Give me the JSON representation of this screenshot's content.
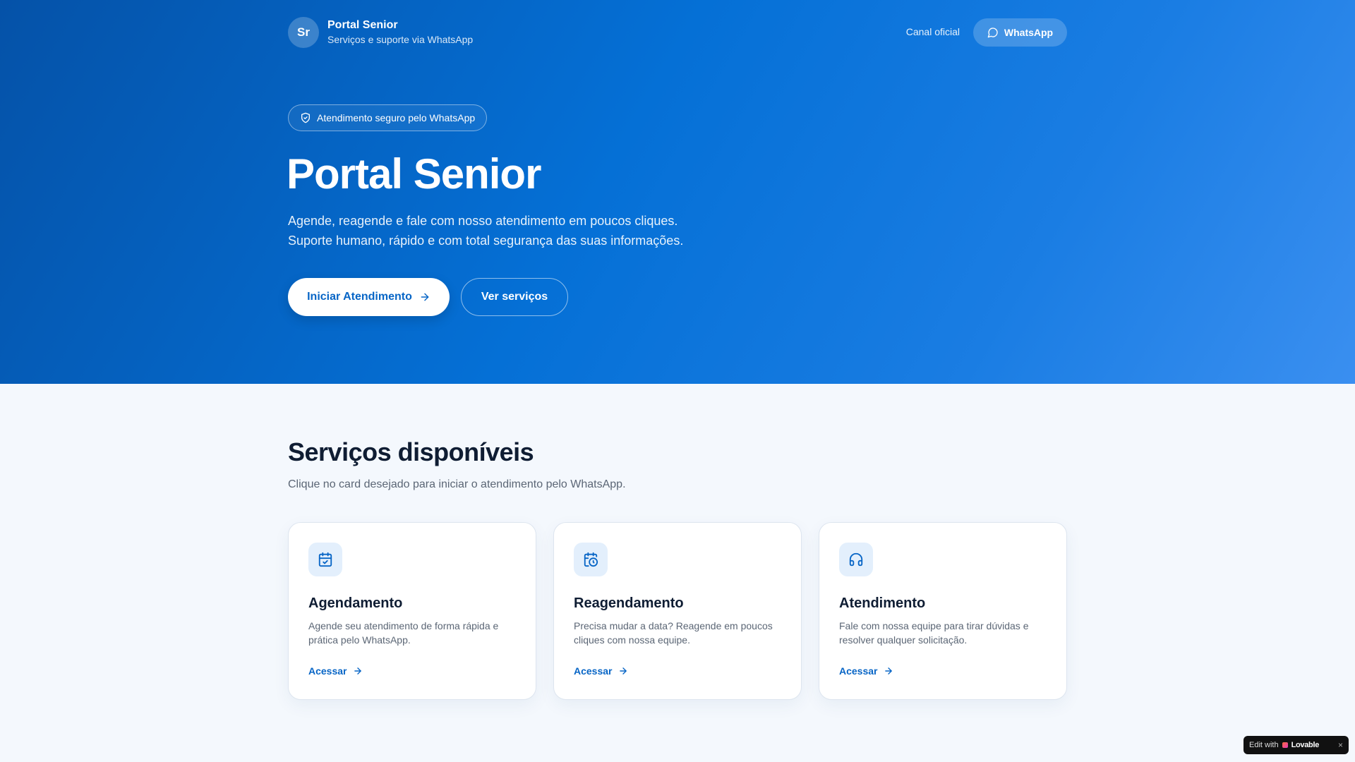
{
  "header": {
    "avatar_initials": "Sr",
    "brand_name": "Portal Senior",
    "brand_subtitle": "Serviços e suporte via WhatsApp",
    "canal_link": "Canal oficial",
    "whatsapp_button": "WhatsApp"
  },
  "hero": {
    "badge": "Atendimento seguro pelo WhatsApp",
    "title": "Portal Senior",
    "subtitle_line1": "Agende, reagende e fale com nosso atendimento em poucos cliques.",
    "subtitle_line2": "Suporte humano, rápido e com total segurança das suas informações.",
    "primary_button": "Iniciar Atendimento",
    "secondary_button": "Ver serviços"
  },
  "services": {
    "title": "Serviços disponíveis",
    "subtitle": "Clique no card desejado para iniciar o atendimento pelo WhatsApp.",
    "cards": [
      {
        "icon": "calendar-check-icon",
        "title": "Agendamento",
        "description": "Agende seu atendimento de forma rápida e prática pelo WhatsApp.",
        "link": "Acessar"
      },
      {
        "icon": "calendar-clock-icon",
        "title": "Reagendamento",
        "description": "Precisa mudar a data? Reagende em poucos cliques com nossa equipe.",
        "link": "Acessar"
      },
      {
        "icon": "headphones-icon",
        "title": "Atendimento",
        "description": "Fale com nossa equipe para tirar dúvidas e resolver qualquer solicitação.",
        "link": "Acessar"
      }
    ]
  },
  "lovable_badge": {
    "prefix": "Edit with",
    "brand": "Lovable",
    "close": "×"
  },
  "colors": {
    "hero_gradient_start": "#0552a8",
    "hero_gradient_end": "#3a8ff0",
    "accent": "#0765c6",
    "page_background": "#f4f8fd"
  }
}
